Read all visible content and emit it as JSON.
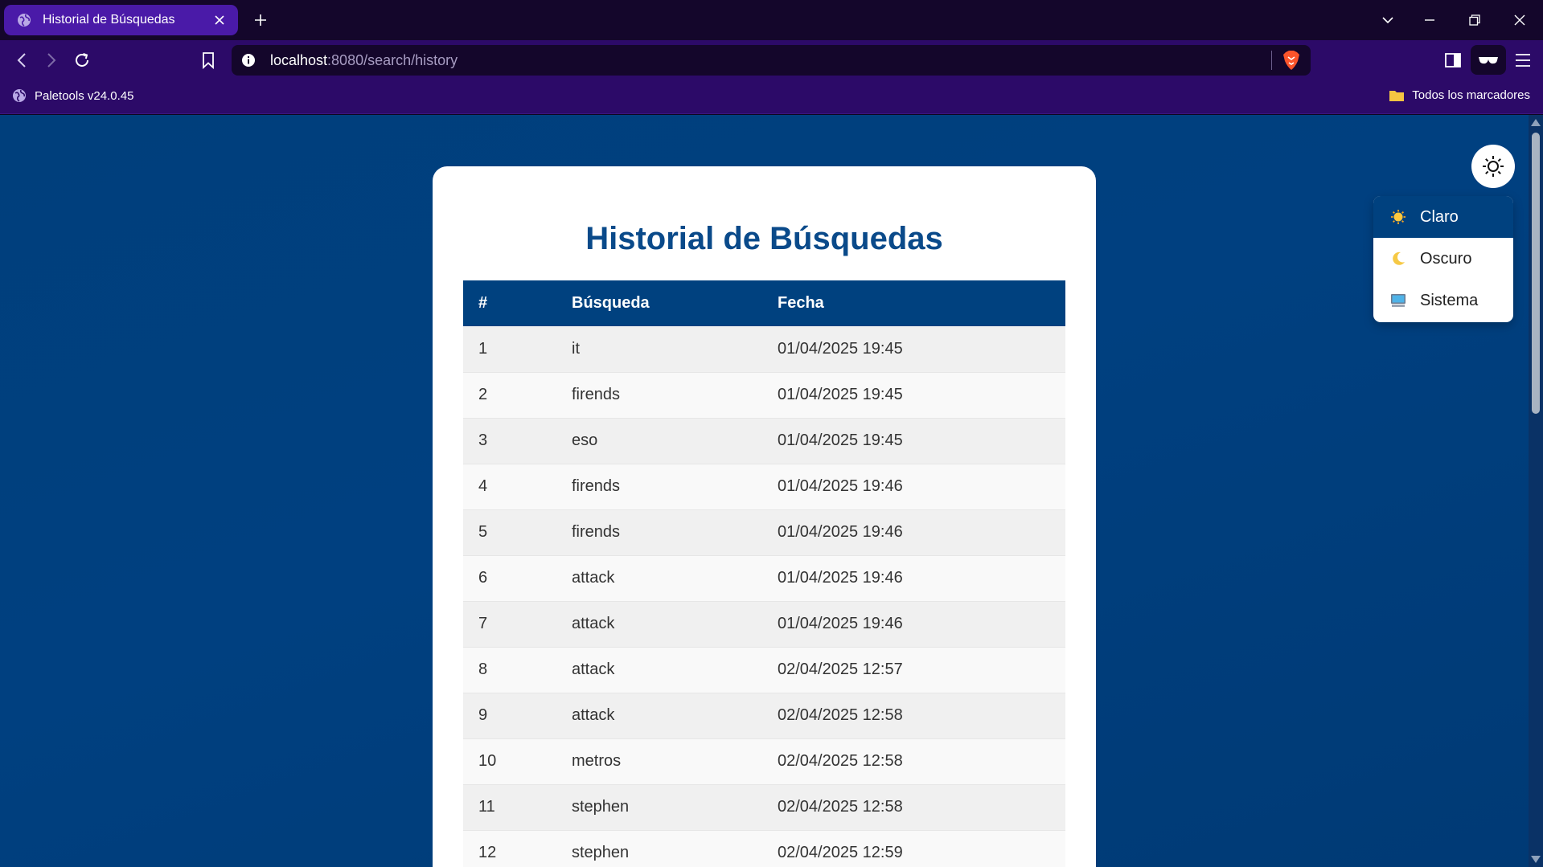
{
  "browser": {
    "tab_title": "Historial de Búsquedas",
    "url_host": "localhost",
    "url_path": ":8080/search/history",
    "bookmark_left": "Paletools v24.0.45",
    "bookmark_right": "Todos los marcadores"
  },
  "page": {
    "title": "Historial de Búsquedas",
    "table": {
      "headers": [
        "#",
        "Búsqueda",
        "Fecha"
      ],
      "rows": [
        [
          "1",
          "it",
          "01/04/2025 19:45"
        ],
        [
          "2",
          "firends",
          "01/04/2025 19:45"
        ],
        [
          "3",
          "eso",
          "01/04/2025 19:45"
        ],
        [
          "4",
          "firends",
          "01/04/2025 19:46"
        ],
        [
          "5",
          "firends",
          "01/04/2025 19:46"
        ],
        [
          "6",
          "attack",
          "01/04/2025 19:46"
        ],
        [
          "7",
          "attack",
          "01/04/2025 19:46"
        ],
        [
          "8",
          "attack",
          "02/04/2025 12:57"
        ],
        [
          "9",
          "attack",
          "02/04/2025 12:58"
        ],
        [
          "10",
          "metros",
          "02/04/2025 12:58"
        ],
        [
          "11",
          "stephen",
          "02/04/2025 12:58"
        ],
        [
          "12",
          "stephen",
          "02/04/2025 12:59"
        ]
      ]
    }
  },
  "theme_menu": {
    "items": [
      {
        "label": "Claro",
        "icon": "sun-emoji-icon",
        "active": true
      },
      {
        "label": "Oscuro",
        "icon": "moon-emoji-icon",
        "active": false
      },
      {
        "label": "Sistema",
        "icon": "computer-emoji-icon",
        "active": false
      }
    ]
  },
  "colors": {
    "brand_blue": "#00417f",
    "title_blue": "#0a4a8a",
    "browser_purple": "#2c0a68",
    "active_tab": "#4a1aa8"
  }
}
